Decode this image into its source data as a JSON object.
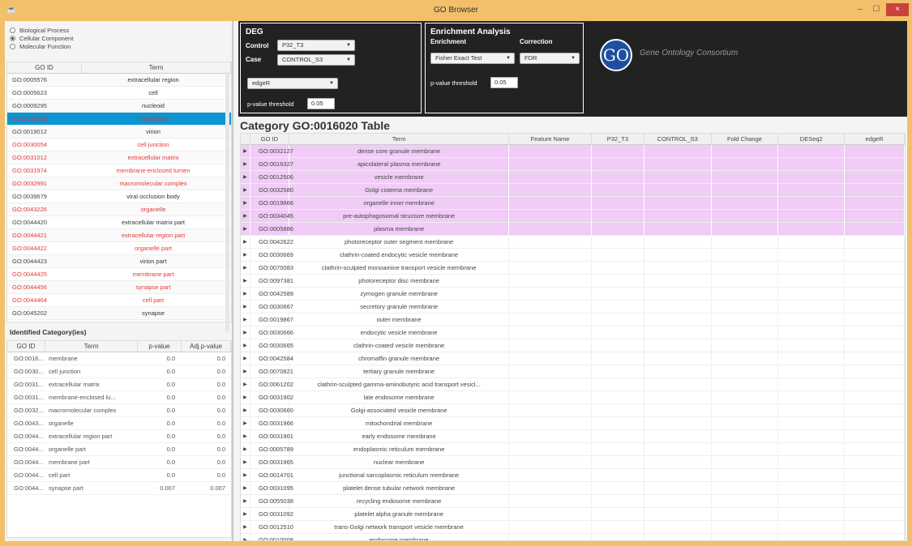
{
  "window": {
    "title": "GO Browser",
    "min": "–",
    "max": "☐",
    "close": "×"
  },
  "ontology": {
    "options": [
      {
        "label": "Biological Process",
        "selected": false
      },
      {
        "label": "Cellular Component",
        "selected": true
      },
      {
        "label": "Molecular Function",
        "selected": false
      }
    ]
  },
  "go_table": {
    "headers": [
      "GO ID",
      "Term"
    ],
    "rows": [
      {
        "id": "GO:0005576",
        "term": "extracellular region",
        "state": "normal"
      },
      {
        "id": "GO:0005623",
        "term": "cell",
        "state": "normal"
      },
      {
        "id": "GO:0009295",
        "term": "nucleoid",
        "state": "normal"
      },
      {
        "id": "GO:0016020",
        "term": "membrane",
        "state": "selected"
      },
      {
        "id": "GO:0019012",
        "term": "virion",
        "state": "normal"
      },
      {
        "id": "GO:0030054",
        "term": "cell junction",
        "state": "red"
      },
      {
        "id": "GO:0031012",
        "term": "extracellular matrix",
        "state": "red"
      },
      {
        "id": "GO:0031974",
        "term": "membrane-enclosed lumen",
        "state": "red"
      },
      {
        "id": "GO:0032991",
        "term": "macromolecular complex",
        "state": "red"
      },
      {
        "id": "GO:0039679",
        "term": "viral occlusion body",
        "state": "normal"
      },
      {
        "id": "GO:0043226",
        "term": "organelle",
        "state": "red"
      },
      {
        "id": "GO:0044420",
        "term": "extracellular matrix part",
        "state": "normal"
      },
      {
        "id": "GO:0044421",
        "term": "extracellular region part",
        "state": "red"
      },
      {
        "id": "GO:0044422",
        "term": "organelle part",
        "state": "red"
      },
      {
        "id": "GO:0044423",
        "term": "virion part",
        "state": "normal"
      },
      {
        "id": "GO:0044425",
        "term": "membrane part",
        "state": "red"
      },
      {
        "id": "GO:0044456",
        "term": "synapse part",
        "state": "red"
      },
      {
        "id": "GO:0044464",
        "term": "cell part",
        "state": "red"
      },
      {
        "id": "GO:0045202",
        "term": "synapse",
        "state": "normal"
      }
    ]
  },
  "identified": {
    "title": "Identified Category(ies)",
    "headers": [
      "GO ID",
      "Term",
      "p-value",
      "Adj.p-value"
    ],
    "rows": [
      {
        "id": "GO:0016...",
        "term": "membrane",
        "p": "0.0",
        "adj": "0.0"
      },
      {
        "id": "GO:0030...",
        "term": "cell junction",
        "p": "0.0",
        "adj": "0.0"
      },
      {
        "id": "GO:0031...",
        "term": "extracellular matrix",
        "p": "0.0",
        "adj": "0.0"
      },
      {
        "id": "GO:0031...",
        "term": "membrane-enclosed lu...",
        "p": "0.0",
        "adj": "0.0"
      },
      {
        "id": "GO:0032...",
        "term": "macromolecular complex",
        "p": "0.0",
        "adj": "0.0"
      },
      {
        "id": "GO:0043...",
        "term": "organelle",
        "p": "0.0",
        "adj": "0.0"
      },
      {
        "id": "GO:0044...",
        "term": "extracellular region part",
        "p": "0.0",
        "adj": "0.0"
      },
      {
        "id": "GO:0044...",
        "term": "organelle part",
        "p": "0.0",
        "adj": "0.0"
      },
      {
        "id": "GO:0044...",
        "term": "membrane part",
        "p": "0.0",
        "adj": "0.0"
      },
      {
        "id": "GO:0044...",
        "term": "cell part",
        "p": "0.0",
        "adj": "0.0"
      },
      {
        "id": "GO:0044...",
        "term": "synapse part",
        "p": "0.007",
        "adj": "0.007"
      }
    ]
  },
  "deg": {
    "title": "DEG",
    "control_label": "Control",
    "control_value": "P32_T3",
    "case_label": "Case",
    "case_value": "CONTROL_S3",
    "method_value": "edgeR",
    "pthr_label": "p-value threshold",
    "pthr_value": "0.05"
  },
  "enrichment": {
    "title": "Enrichment Analysis",
    "enrichment_label": "Enrichment",
    "correction_label": "Correction",
    "test_value": "Fisher Exact Test",
    "correction_value": "FDR",
    "pthr_label": "p-value threshold",
    "pthr_value": "0.05"
  },
  "logo": {
    "text": "Gene Ontology Consortium",
    "glyph": "GO"
  },
  "category": {
    "title": "Category GO:0016020 Table",
    "headers": [
      "GO ID",
      "Term",
      "Feature Name",
      "P32_T3",
      "CONTROL_S3",
      "Fold Change",
      "DESeq2",
      "edgeR"
    ],
    "rows": [
      {
        "id": "GO:0032127",
        "term": "dense core granule membrane",
        "pink": true
      },
      {
        "id": "GO:0016327",
        "term": "apicolateral plasma membrane",
        "pink": true
      },
      {
        "id": "GO:0012506",
        "term": "vesicle membrane",
        "pink": true
      },
      {
        "id": "GO:0032580",
        "term": "Golgi cisterna membrane",
        "pink": true
      },
      {
        "id": "GO:0019866",
        "term": "organelle inner membrane",
        "pink": true
      },
      {
        "id": "GO:0034045",
        "term": "pre-autophagosomal structure membrane",
        "pink": true
      },
      {
        "id": "GO:0005886",
        "term": "plasma membrane",
        "pink": true
      },
      {
        "id": "GO:0042622",
        "term": "photoreceptor outer segment membrane",
        "pink": false
      },
      {
        "id": "GO:0030669",
        "term": "clathrin-coated endocytic vesicle membrane",
        "pink": false
      },
      {
        "id": "GO:0070083",
        "term": "clathrin-sculpted monoamine transport vesicle membrane",
        "pink": false
      },
      {
        "id": "GO:0097381",
        "term": "photoreceptor disc membrane",
        "pink": false
      },
      {
        "id": "GO:0042589",
        "term": "zymogen granule membrane",
        "pink": false
      },
      {
        "id": "GO:0030667",
        "term": "secretory granule membrane",
        "pink": false
      },
      {
        "id": "GO:0019867",
        "term": "outer membrane",
        "pink": false
      },
      {
        "id": "GO:0030666",
        "term": "endocytic vesicle membrane",
        "pink": false
      },
      {
        "id": "GO:0030665",
        "term": "clathrin-coated vesicle membrane",
        "pink": false
      },
      {
        "id": "GO:0042584",
        "term": "chromaffin granule membrane",
        "pink": false
      },
      {
        "id": "GO:0070821",
        "term": "tertiary granule membrane",
        "pink": false
      },
      {
        "id": "GO:0061202",
        "term": "clathrin-sculpted gamma-aminobutyric acid transport vesicl...",
        "pink": false
      },
      {
        "id": "GO:0031902",
        "term": "late endosome membrane",
        "pink": false
      },
      {
        "id": "GO:0030660",
        "term": "Golgi-associated vesicle membrane",
        "pink": false
      },
      {
        "id": "GO:0031966",
        "term": "mitochondrial membrane",
        "pink": false
      },
      {
        "id": "GO:0031901",
        "term": "early endosome membrane",
        "pink": false
      },
      {
        "id": "GO:0005789",
        "term": "endoplasmic reticulum membrane",
        "pink": false
      },
      {
        "id": "GO:0031965",
        "term": "nuclear membrane",
        "pink": false
      },
      {
        "id": "GO:0014701",
        "term": "junctional sarcoplasmic reticulum membrane",
        "pink": false
      },
      {
        "id": "GO:0031095",
        "term": "platelet dense tubular network membrane",
        "pink": false
      },
      {
        "id": "GO:0055038",
        "term": "recycling endosome membrane",
        "pink": false
      },
      {
        "id": "GO:0031092",
        "term": "platelet alpha granule membrane",
        "pink": false
      },
      {
        "id": "GO:0012510",
        "term": "trans-Golgi network transport vesicle membrane",
        "pink": false
      },
      {
        "id": "GO:0010008",
        "term": "endosome membrane",
        "pink": false
      }
    ]
  }
}
